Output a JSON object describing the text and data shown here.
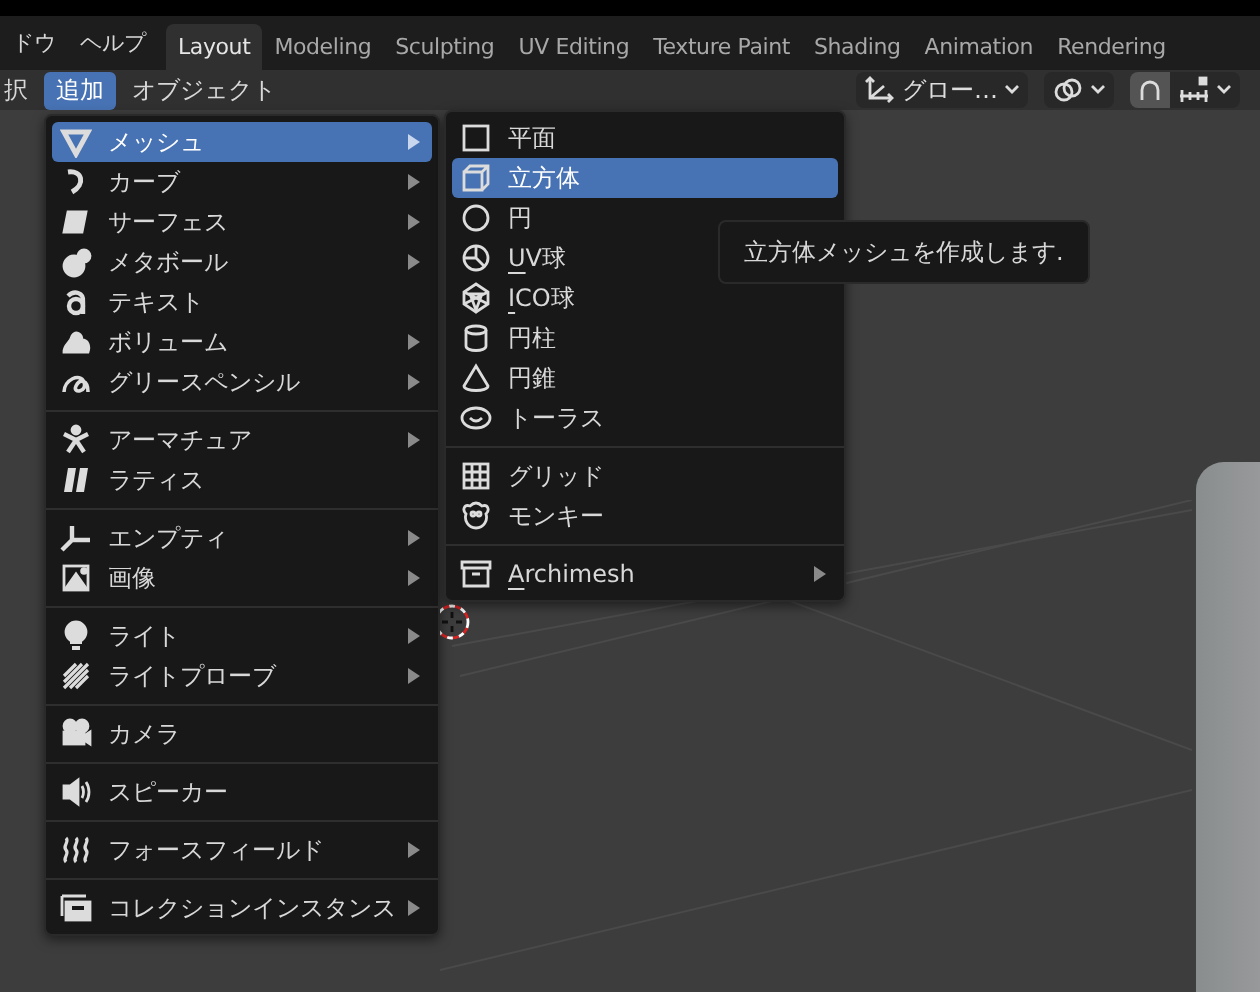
{
  "top_menu": [
    {
      "label": "ドウ"
    },
    {
      "label": "ヘルプ"
    }
  ],
  "workspace_tabs": [
    {
      "label": "Layout",
      "selected": true
    },
    {
      "label": "Modeling",
      "selected": false
    },
    {
      "label": "Sculpting",
      "selected": false
    },
    {
      "label": "UV Editing",
      "selected": false
    },
    {
      "label": "Texture Paint",
      "selected": false
    },
    {
      "label": "Shading",
      "selected": false
    },
    {
      "label": "Animation",
      "selected": false
    },
    {
      "label": "Rendering",
      "selected": false
    }
  ],
  "header_menu": [
    {
      "label": "択",
      "selected": false
    },
    {
      "label": "追加",
      "selected": true
    },
    {
      "label": "オブジェクト",
      "selected": false
    }
  ],
  "header_tools": {
    "orientation": "グロー…",
    "snap": {
      "on": true
    }
  },
  "add_menu": {
    "items": [
      {
        "kind": "item",
        "label": "メッシュ",
        "submenu": true,
        "selected": true
      },
      {
        "kind": "item",
        "label": "カーブ",
        "submenu": true,
        "selected": false
      },
      {
        "kind": "item",
        "label": "サーフェス",
        "submenu": true,
        "selected": false
      },
      {
        "kind": "item",
        "label": "メタボール",
        "submenu": true,
        "selected": false
      },
      {
        "kind": "item",
        "label": "テキスト",
        "submenu": false,
        "selected": false
      },
      {
        "kind": "item",
        "label": "ボリューム",
        "submenu": true,
        "selected": false
      },
      {
        "kind": "item",
        "label": "グリースペンシル",
        "submenu": true,
        "selected": false
      },
      {
        "kind": "separator"
      },
      {
        "kind": "item",
        "label": "アーマチュア",
        "submenu": true,
        "selected": false
      },
      {
        "kind": "item",
        "label": "ラティス",
        "submenu": false,
        "selected": false
      },
      {
        "kind": "separator"
      },
      {
        "kind": "item",
        "label": "エンプティ",
        "submenu": true,
        "selected": false
      },
      {
        "kind": "item",
        "label": "画像",
        "submenu": true,
        "selected": false
      },
      {
        "kind": "separator"
      },
      {
        "kind": "item",
        "label": "ライト",
        "submenu": true,
        "selected": false
      },
      {
        "kind": "item",
        "label": "ライトプローブ",
        "submenu": true,
        "selected": false
      },
      {
        "kind": "separator"
      },
      {
        "kind": "item",
        "label": "カメラ",
        "submenu": false,
        "selected": false
      },
      {
        "kind": "separator"
      },
      {
        "kind": "item",
        "label": "スピーカー",
        "submenu": false,
        "selected": false
      },
      {
        "kind": "separator"
      },
      {
        "kind": "item",
        "label": "フォースフィールド",
        "submenu": true,
        "selected": false
      },
      {
        "kind": "separator"
      },
      {
        "kind": "item",
        "label": "コレクションインスタンス",
        "submenu": true,
        "selected": false
      }
    ]
  },
  "mesh_menu": {
    "items": [
      {
        "kind": "item",
        "label": "平面",
        "submenu": false,
        "selected": false,
        "underline_first": false
      },
      {
        "kind": "item",
        "label": "立方体",
        "submenu": false,
        "selected": true,
        "underline_first": false
      },
      {
        "kind": "item",
        "label": "円",
        "submenu": false,
        "selected": false,
        "underline_first": false
      },
      {
        "kind": "item",
        "label": "UV球",
        "submenu": false,
        "selected": false,
        "underline_first": true
      },
      {
        "kind": "item",
        "label": "ICO球",
        "submenu": false,
        "selected": false,
        "underline_first": true
      },
      {
        "kind": "item",
        "label": "円柱",
        "submenu": false,
        "selected": false,
        "underline_first": false
      },
      {
        "kind": "item",
        "label": "円錐",
        "submenu": false,
        "selected": false,
        "underline_first": false
      },
      {
        "kind": "item",
        "label": "トーラス",
        "submenu": false,
        "selected": false,
        "underline_first": false
      },
      {
        "kind": "separator"
      },
      {
        "kind": "item",
        "label": "グリッド",
        "submenu": false,
        "selected": false,
        "underline_first": false
      },
      {
        "kind": "item",
        "label": "モンキー",
        "submenu": false,
        "selected": false,
        "underline_first": false
      },
      {
        "kind": "separator"
      },
      {
        "kind": "item",
        "label": "Archimesh",
        "submenu": true,
        "selected": false,
        "underline_first": true
      }
    ]
  },
  "tooltip": {
    "text": "立方体メッシュを作成します."
  }
}
